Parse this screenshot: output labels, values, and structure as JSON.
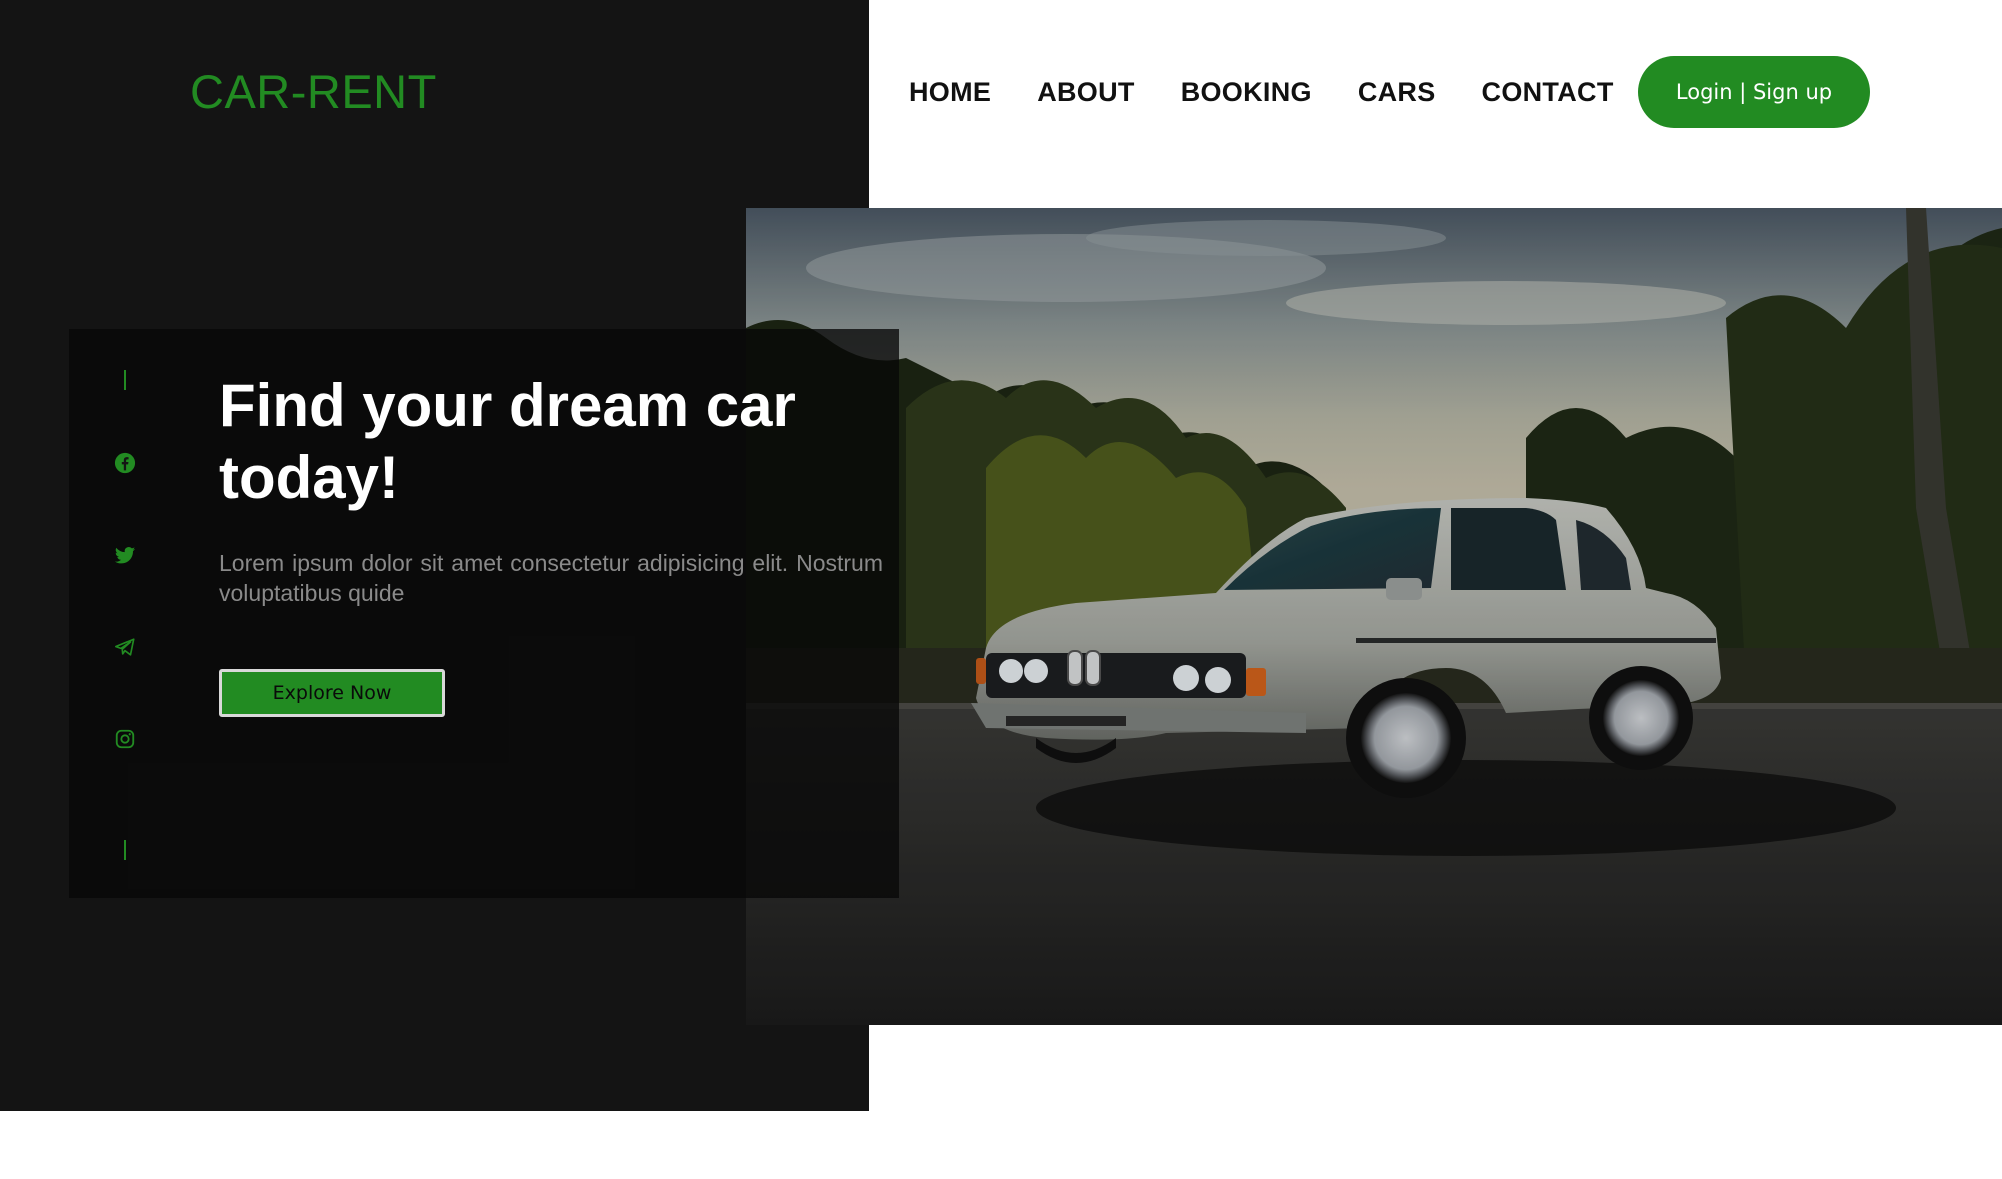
{
  "brand": {
    "logo": "CAR-RENT",
    "accent_color": "#228B22"
  },
  "nav": {
    "items": [
      {
        "label": "HOME"
      },
      {
        "label": "ABOUT"
      },
      {
        "label": "BOOKING"
      },
      {
        "label": "CARS"
      },
      {
        "label": "CONTACT"
      }
    ],
    "login_label": "Login | Sign up"
  },
  "hero": {
    "headline": "Find your dream car today!",
    "description": "Lorem ipsum dolor sit amet consectetur adipisicing elit. Nostrum voluptatibus quide",
    "cta_label": "Explore Now",
    "image_subject": "silver vintage sedan parked on asphalt at dusk with trees"
  },
  "social": {
    "icons": [
      "facebook-icon",
      "twitter-icon",
      "telegram-icon",
      "instagram-icon"
    ]
  }
}
